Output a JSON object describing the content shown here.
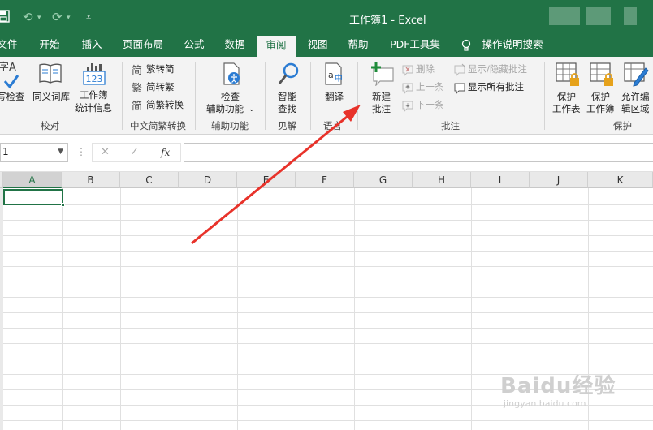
{
  "window": {
    "title": "工作簿1 - Excel",
    "accent_color": "#217346"
  },
  "quick_access": {
    "save_icon": "save-icon",
    "undo_icon": "undo-icon",
    "redo_icon": "redo-icon",
    "customize_icon": "customize-quick-access-icon"
  },
  "menu": {
    "tabs": [
      {
        "label": "文件"
      },
      {
        "label": "开始"
      },
      {
        "label": "插入"
      },
      {
        "label": "页面布局"
      },
      {
        "label": "公式"
      },
      {
        "label": "数据"
      },
      {
        "label": "审阅",
        "active": true
      },
      {
        "label": "视图"
      },
      {
        "label": "帮助"
      },
      {
        "label": "PDF工具集"
      },
      {
        "label": "操作说明搜索"
      }
    ]
  },
  "ribbon": {
    "proofing": {
      "group_label": "校对",
      "spell_check_line1": "字A",
      "spell_check_label": "写检查",
      "thesaurus_label": "同义词库",
      "stats_line1": "工作簿",
      "stats_line2": "统计信息"
    },
    "chinese_conversion": {
      "group_label": "中文简繁转换",
      "to_simplified": "繁转简",
      "to_traditional": "简转繁",
      "convert": "简繁转换"
    },
    "accessibility": {
      "group_label": "辅助功能",
      "check_line1": "检查",
      "check_line2": "辅助功能"
    },
    "insights": {
      "group_label": "见解",
      "smart_lookup_line1": "智能",
      "smart_lookup_line2": "查找"
    },
    "language": {
      "group_label": "语言",
      "translate_label": "翻译"
    },
    "comments": {
      "group_label": "批注",
      "new_line1": "新建",
      "new_line2": "批注",
      "delete": "删除",
      "previous": "上一条",
      "next": "下一条",
      "show_hide": "显示/隐藏批注",
      "show_all": "显示所有批注"
    },
    "protect": {
      "group_label": "保护",
      "protect_sheet_line1": "保护",
      "protect_sheet_line2": "工作表",
      "protect_workbook_line1": "保护",
      "protect_workbook_line2": "工作簿",
      "allow_edit_line1": "允许编",
      "allow_edit_line2": "辑区域"
    }
  },
  "formula_bar": {
    "name_box_value": "1",
    "cancel_glyph": "✕",
    "enter_glyph": "✓",
    "fx_label": "fx",
    "formula_value": ""
  },
  "sheet": {
    "columns": [
      "A",
      "B",
      "C",
      "D",
      "E",
      "F",
      "G",
      "H",
      "I",
      "J",
      "K"
    ],
    "selected_column": "A",
    "active_cell": "A1"
  },
  "watermark": {
    "text": "Baidu经验",
    "url": "jingyan.baidu.com"
  }
}
